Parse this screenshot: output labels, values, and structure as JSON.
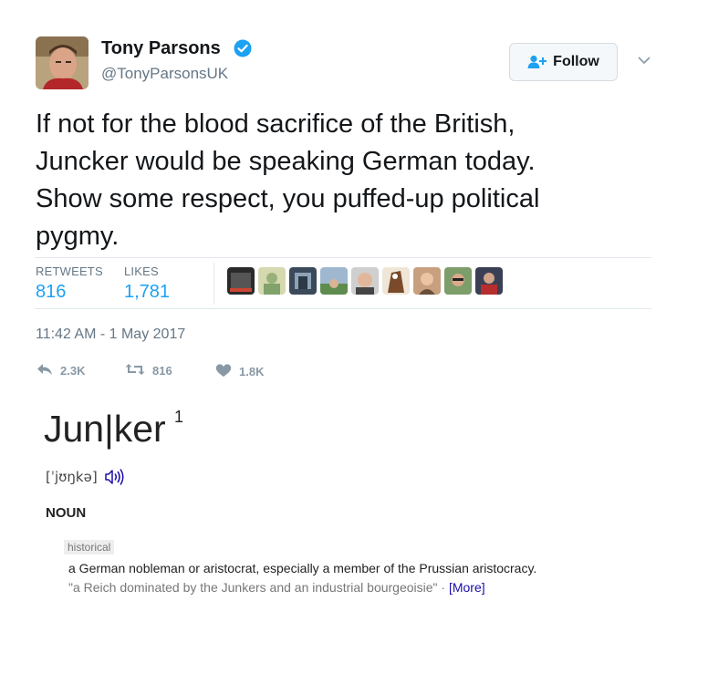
{
  "user": {
    "name": "Tony Parsons",
    "handle": "@TonyParsonsUK",
    "verified_color": "#1da1f2"
  },
  "follow_button": {
    "label": "Follow",
    "icon": "add-user-icon"
  },
  "tweet": {
    "text": "If not for the blood sacrifice of the British,\nJuncker would be speaking German today.\nShow some respect, you puffed-up political\npygmy.",
    "timestamp": "11:42 AM - 1 May 2017"
  },
  "stats": {
    "retweets_label": "RETWEETS",
    "retweets_value": "816",
    "likes_label": "LIKES",
    "likes_value": "1,781",
    "liker_avatar_count": 9
  },
  "actions": {
    "reply_count": "2.3K",
    "retweet_count": "816",
    "like_count": "1.8K"
  },
  "dictionary": {
    "headword": "Jun|ker",
    "superscript": "1",
    "phonetic": "[ˈjʊŋkə]",
    "part_of_speech": "NOUN",
    "usage_tag": "historical",
    "definition": "a German nobleman or aristocrat, especially a member of the Prussian aristocracy.",
    "example": "\"a Reich dominated by the Junkers and an industrial bourgeoisie\" · ",
    "more_link": "[More]"
  },
  "colors": {
    "accent": "#1da1f2",
    "muted": "#657786",
    "action_grey": "#8899a6",
    "link": "#1a0dab"
  }
}
